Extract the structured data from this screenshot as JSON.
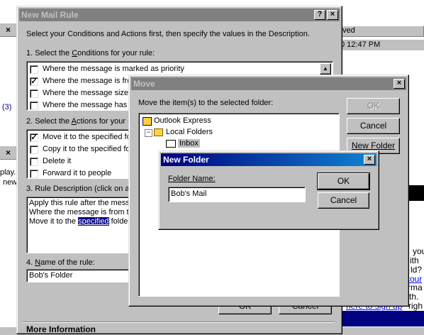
{
  "bg": {
    "col_header": "ved",
    "time": "0 12:47 PM",
    "count": "(3)",
    "left_text1": "play.",
    "left_text2": "new",
    "right_texts": [
      "you",
      "ith",
      "ld?",
      "cour",
      "rma",
      "rth.",
      "righ"
    ],
    "signup_text": "here to sign up",
    "more_info": "More Information"
  },
  "rule": {
    "title": "New Mail Rule",
    "instructions": "Select your Conditions and Actions first, then specify the values in the Description.",
    "cond_label_pre": "1. Select the ",
    "cond_label_acc": "C",
    "cond_label_post": "onditions for your rule:",
    "conditions": [
      {
        "label": "Where the message is marked as priority",
        "checked": false
      },
      {
        "label": "Where the message is fro",
        "checked": true
      },
      {
        "label": "Where the message size i",
        "checked": false
      },
      {
        "label": "Where the message has a",
        "checked": false
      }
    ],
    "act_label_pre": "2. Select the ",
    "act_label_acc": "A",
    "act_label_post": "ctions for your r",
    "actions": [
      {
        "label": "Move it to the specified fo",
        "checked": true
      },
      {
        "label": "Copy it to the specified fol",
        "checked": false
      },
      {
        "label": "Delete it",
        "checked": false
      },
      {
        "label": "Forward it to people",
        "checked": false
      }
    ],
    "desc_label": "3. Rule Description (click on a",
    "desc_lines": [
      "Apply this rule after the messa",
      "Where the message is from th"
    ],
    "desc_line3_pre": "Move it to the ",
    "desc_line3_link": "specified",
    "desc_line3_post": " folder",
    "name_label_pre": "4. ",
    "name_label_acc": "N",
    "name_label_post": "ame of the rule:",
    "name_value": "Bob's Folder",
    "ok_label": "OK",
    "cancel_label": "Cancel"
  },
  "move": {
    "title": "Move",
    "instruction": "Move the item(s) to the selected folder:",
    "tree": {
      "root": "Outlook Express",
      "local": "Local Folders",
      "inbox": "Inbox"
    },
    "ok_label": "OK",
    "cancel_label": "Cancel",
    "new_folder_label": "New Folder"
  },
  "newfolder": {
    "title": "New Folder",
    "field_label": "Folder Name:",
    "field_value": "Bob's Mail",
    "ok_label": "OK",
    "cancel_label": "Cancel"
  },
  "colors": {
    "title_active": "#000080",
    "title_inactive": "#808080",
    "face": "#c0c0c0",
    "link": "#0000ff"
  }
}
